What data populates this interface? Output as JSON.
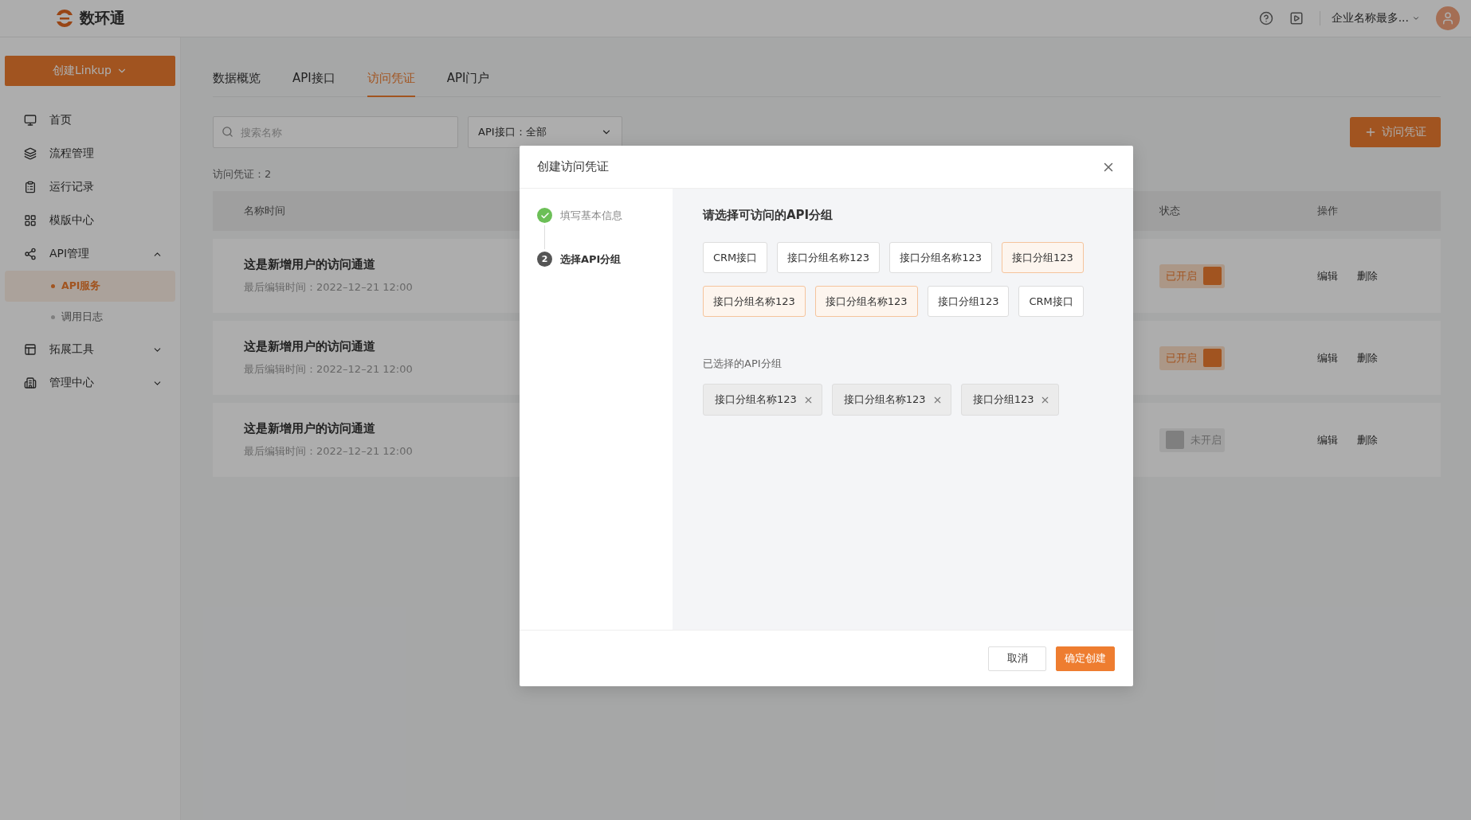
{
  "header": {
    "logo_text": "数环通",
    "company": "企业名称最多..."
  },
  "sidebar": {
    "create_button": "创建Linkup",
    "items": [
      {
        "label": "首页"
      },
      {
        "label": "流程管理"
      },
      {
        "label": "运行记录"
      },
      {
        "label": "模版中心"
      },
      {
        "label": "API管理",
        "expanded": true,
        "children": [
          {
            "label": "API服务",
            "selected": true
          },
          {
            "label": "调用日志",
            "selected": false
          }
        ]
      },
      {
        "label": "拓展工具",
        "expanded": false
      },
      {
        "label": "管理中心",
        "expanded": false
      }
    ]
  },
  "tabs": [
    {
      "label": "数据概览",
      "selected": false
    },
    {
      "label": "API接口",
      "selected": false
    },
    {
      "label": "访问凭证",
      "selected": true
    },
    {
      "label": "API门户",
      "selected": false
    }
  ],
  "search": {
    "placeholder": "搜索名称"
  },
  "filter": {
    "value": "API接口：全部"
  },
  "add_button": "访问凭证",
  "count": "访问凭证：2",
  "table": {
    "columns": [
      "名称时间",
      "状态",
      "操作"
    ],
    "rows": [
      {
        "name": "这是新增用户的访问通道",
        "time": "最后编辑时间：2022–12–21 12:00",
        "status": "已开启",
        "on": true,
        "actions": [
          "编辑",
          "删除"
        ]
      },
      {
        "name": "这是新增用户的访问通道",
        "time": "最后编辑时间：2022–12–21 12:00",
        "status": "已开启",
        "on": true,
        "actions": [
          "编辑",
          "删除"
        ]
      },
      {
        "name": "这是新增用户的访问通道",
        "time": "最后编辑时间：2022–12–21 12:00",
        "status": "未开启",
        "on": false,
        "actions": [
          "编辑",
          "删除"
        ]
      }
    ]
  },
  "dialog": {
    "title": "创建访问凭证",
    "steps": [
      {
        "label": "填写基本信息",
        "done": true
      },
      {
        "label": "选择API分组",
        "done": false,
        "number": "2"
      }
    ],
    "heading": "请选择可访问的API分组",
    "groups": [
      {
        "label": "CRM接口",
        "selected": false
      },
      {
        "label": "接口分组名称123",
        "selected": false
      },
      {
        "label": "接口分组名称123",
        "selected": false
      },
      {
        "label": "接口分组123",
        "selected": true
      },
      {
        "label": "接口分组名称123",
        "selected": true
      },
      {
        "label": "接口分组名称123",
        "selected": true
      },
      {
        "label": "接口分组123",
        "selected": false
      },
      {
        "label": "CRM接口",
        "selected": false
      }
    ],
    "chosen_heading": "已选择的API分组",
    "chosen": [
      "接口分组名称123",
      "接口分组名称123",
      "接口分组123"
    ],
    "buttons": [
      "取消",
      "确定创建"
    ]
  }
}
